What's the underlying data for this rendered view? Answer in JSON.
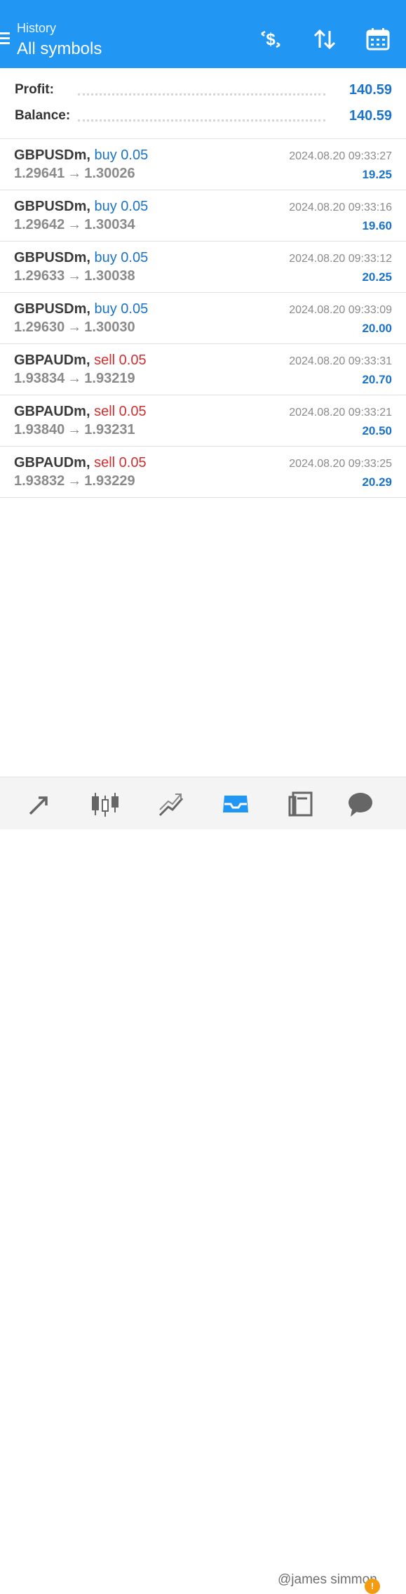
{
  "header": {
    "subtitle": "History",
    "title": "All symbols",
    "accent_color": "#2196f3",
    "buttons": [
      {
        "name": "deposit-dollar-icon"
      },
      {
        "name": "sort-arrows-icon"
      },
      {
        "name": "calendar-icon"
      }
    ]
  },
  "summary": {
    "profit_label": "Profit:",
    "profit_value": "140.59",
    "balance_label": "Balance:",
    "balance_value": "140.59"
  },
  "deals": [
    {
      "symbol": "GBPUSDm,",
      "type": "buy 0.05",
      "side": "buy",
      "open": "1.29641",
      "arrow": "→",
      "close": "1.30026",
      "time": "2024.08.20 09:33:27",
      "profit": "19.25"
    },
    {
      "symbol": "GBPUSDm,",
      "type": "buy 0.05",
      "side": "buy",
      "open": "1.29642",
      "arrow": "→",
      "close": "1.30034",
      "time": "2024.08.20 09:33:16",
      "profit": "19.60"
    },
    {
      "symbol": "GBPUSDm,",
      "type": "buy 0.05",
      "side": "buy",
      "open": "1.29633",
      "arrow": "→",
      "close": "1.30038",
      "time": "2024.08.20 09:33:12",
      "profit": "20.25"
    },
    {
      "symbol": "GBPUSDm,",
      "type": "buy 0.05",
      "side": "buy",
      "open": "1.29630",
      "arrow": "→",
      "close": "1.30030",
      "time": "2024.08.20 09:33:09",
      "profit": "20.00"
    },
    {
      "symbol": "GBPAUDm,",
      "type": "sell 0.05",
      "side": "sell",
      "open": "1.93834",
      "arrow": "→",
      "close": "1.93219",
      "time": "2024.08.20 09:33:31",
      "profit": "20.70"
    },
    {
      "symbol": "GBPAUDm,",
      "type": "sell 0.05",
      "side": "sell",
      "open": "1.93840",
      "arrow": "→",
      "close": "1.93231",
      "time": "2024.08.20 09:33:21",
      "profit": "20.50"
    },
    {
      "symbol": "GBPAUDm,",
      "type": "sell 0.05",
      "side": "sell",
      "open": "1.93832",
      "arrow": "→",
      "close": "1.93229",
      "time": "2024.08.20 09:33:25",
      "profit": "20.29"
    }
  ],
  "bottom_nav": {
    "items": [
      "quotes-arrows-icon",
      "candlestick-chart-icon",
      "trade-chart-icon",
      "history-inbox-icon",
      "news-icon",
      "chat-icon"
    ],
    "active": "history-inbox-icon",
    "chat_badge": "!",
    "watermark": "@james simmon"
  },
  "colors": {
    "buy": "#1a73c9",
    "sell": "#d32f2f",
    "profit": "#1a73c9"
  }
}
